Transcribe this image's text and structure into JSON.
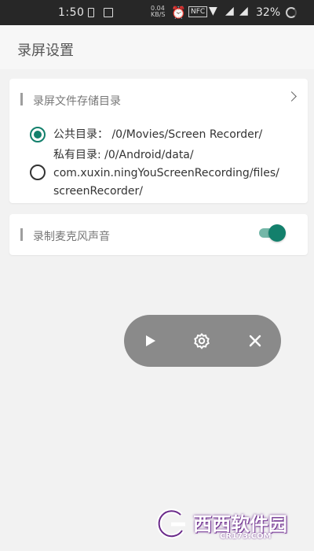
{
  "status_bar": {
    "time": "1:50",
    "network_small": "0.04\nKB/S",
    "nfc": "NFC",
    "battery": "32%",
    "icons": [
      "sim-icon",
      "image-icon",
      "alarm-icon",
      "nfc-icon",
      "wifi-icon",
      "signal-icon",
      "battery-icon"
    ]
  },
  "app_bar": {
    "title": "录屏设置"
  },
  "storage": {
    "section_title": "录屏文件存储目录",
    "options": [
      {
        "label": "公共目录： /0/Movies/Screen Recorder/",
        "selected": true
      },
      {
        "label_lines": [
          "私有目录: /0/Android/data/",
          "com.xuxin.ningYouScreenRecording/files/",
          "screenRecorder/"
        ],
        "selected": false
      }
    ]
  },
  "microphone": {
    "section_title": "录制麦克风声音",
    "enabled": true
  },
  "floating_controls": {
    "icons": [
      "play-icon",
      "gear-icon",
      "close-icon"
    ]
  },
  "watermark": {
    "text": "西西软件园",
    "url": "CR173.COM"
  },
  "colors": {
    "accent": "#13806c",
    "toggle_track": "#74b7a8",
    "float_bar": "#8a8a8a",
    "status_bar": "#272727"
  }
}
